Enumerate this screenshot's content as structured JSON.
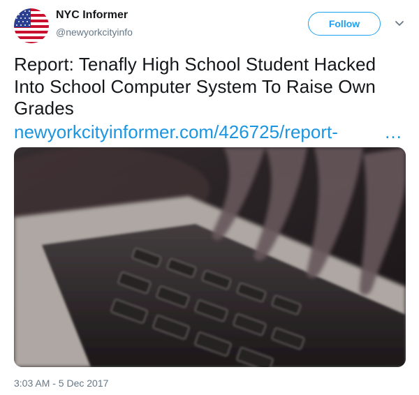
{
  "author": {
    "name": "NYC Informer",
    "handle": "@newyorkcityinfo"
  },
  "actions": {
    "follow_label": "Follow",
    "menu_icon": "chevron-down-icon"
  },
  "tweet": {
    "text": "Report: Tenafly High School Student Hacked Into School Computer System To Raise Own Grades",
    "link": "newyorkcityinformer.com/426725/report-",
    "ellipsis": "…",
    "timestamp": "3:03 AM - 5 Dec 2017"
  },
  "media": {
    "description_icon": "laptop-keyboard-photo"
  },
  "colors": {
    "accent": "#1da1f2",
    "link": "#1b95e0",
    "text": "#14171a",
    "muted": "#657786"
  }
}
